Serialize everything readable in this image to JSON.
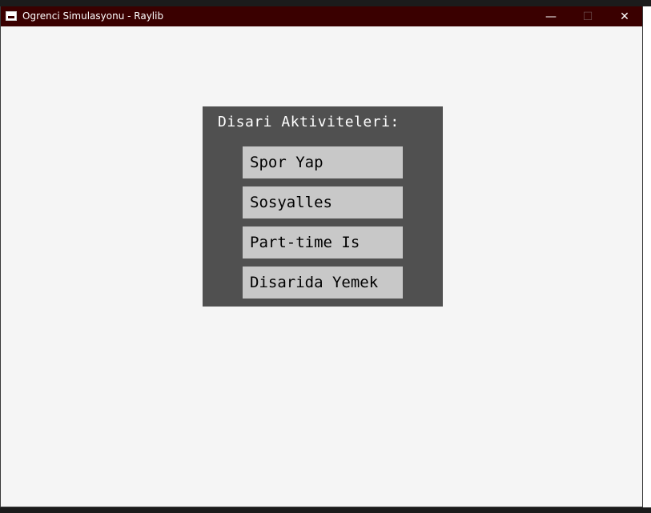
{
  "window": {
    "title": "Ogrenci Simulasyonu - Raylib",
    "minimize_glyph": "—",
    "maximize_glyph": "☐",
    "close_glyph": "✕"
  },
  "panel": {
    "title": "Disari Aktiviteleri:",
    "buttons": [
      {
        "label": "Spor Yap"
      },
      {
        "label": "Sosyalles"
      },
      {
        "label": "Part-time Is"
      },
      {
        "label": "Disarida Yemek"
      }
    ]
  },
  "colors": {
    "titlebar": "#3a0000",
    "background": "#f5f5f5",
    "panel": "#505050",
    "button": "#c8c8c8"
  }
}
